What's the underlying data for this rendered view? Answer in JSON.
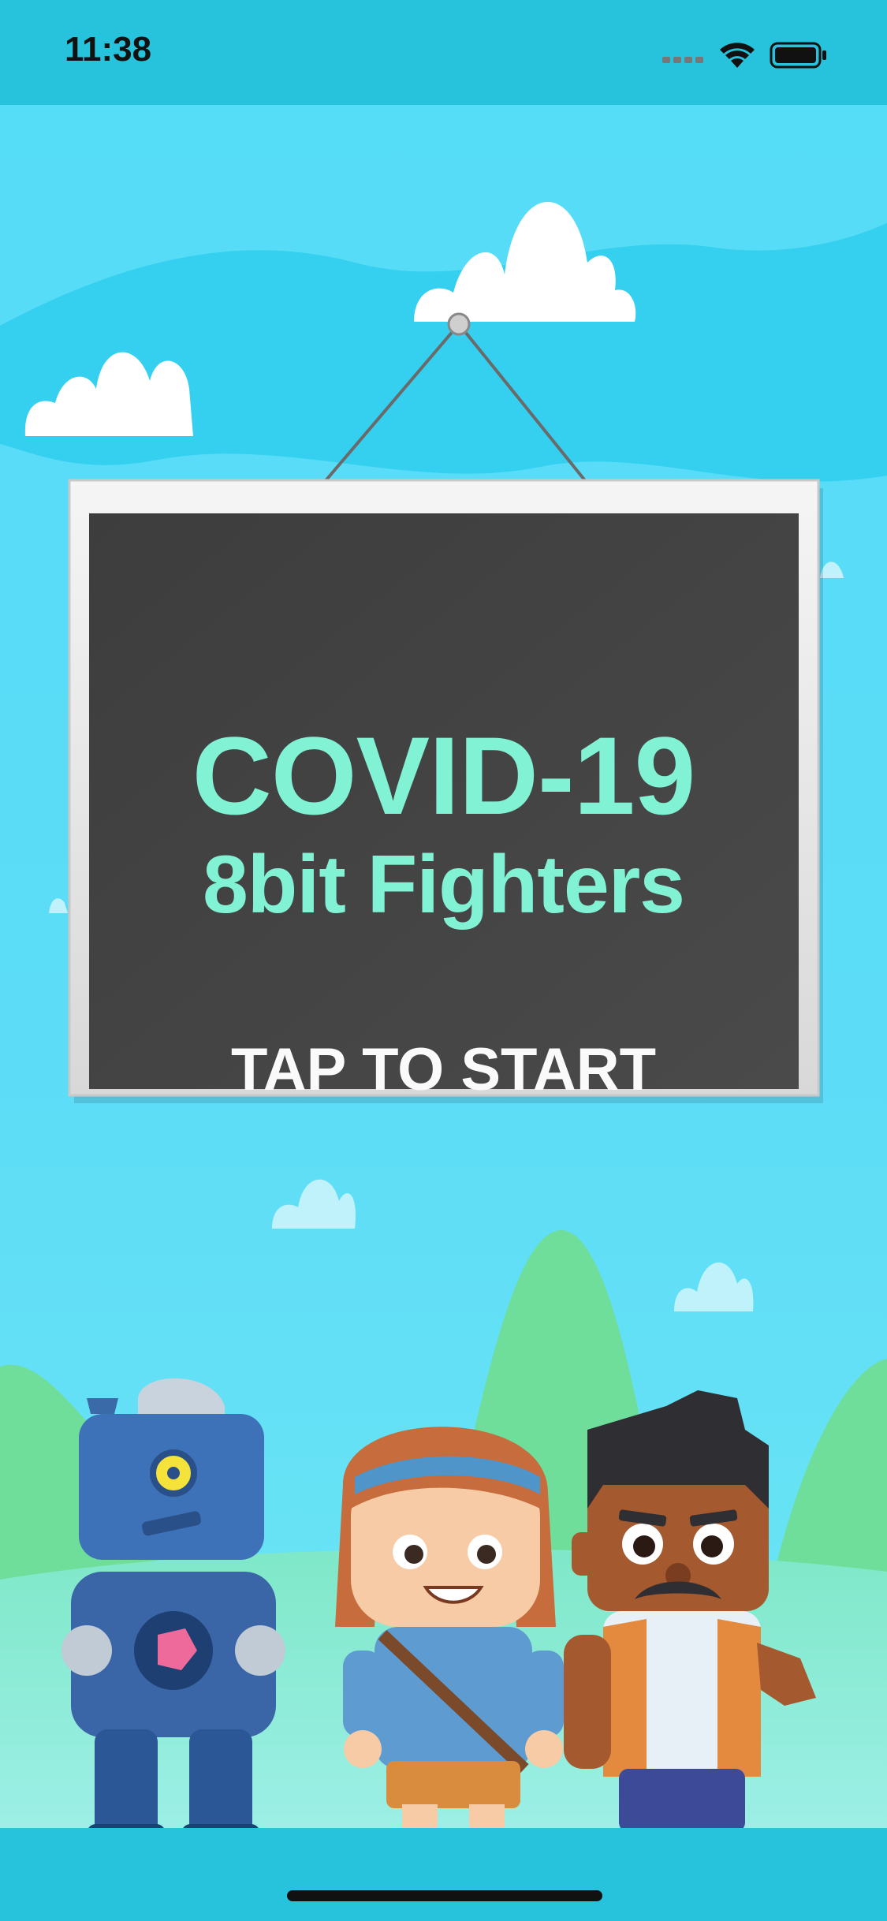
{
  "status_bar": {
    "time": "11:38"
  },
  "sign": {
    "title_line1": "COVID-19",
    "title_line2": "8bit Fighters",
    "tap_label": "TAP TO START"
  },
  "characters": [
    "robot",
    "girl",
    "man"
  ],
  "colors": {
    "sky": "#4fd8f5",
    "board": "#444444",
    "frame": "#ececec",
    "title": "#82f2d4",
    "hills": "#6ede9a"
  }
}
